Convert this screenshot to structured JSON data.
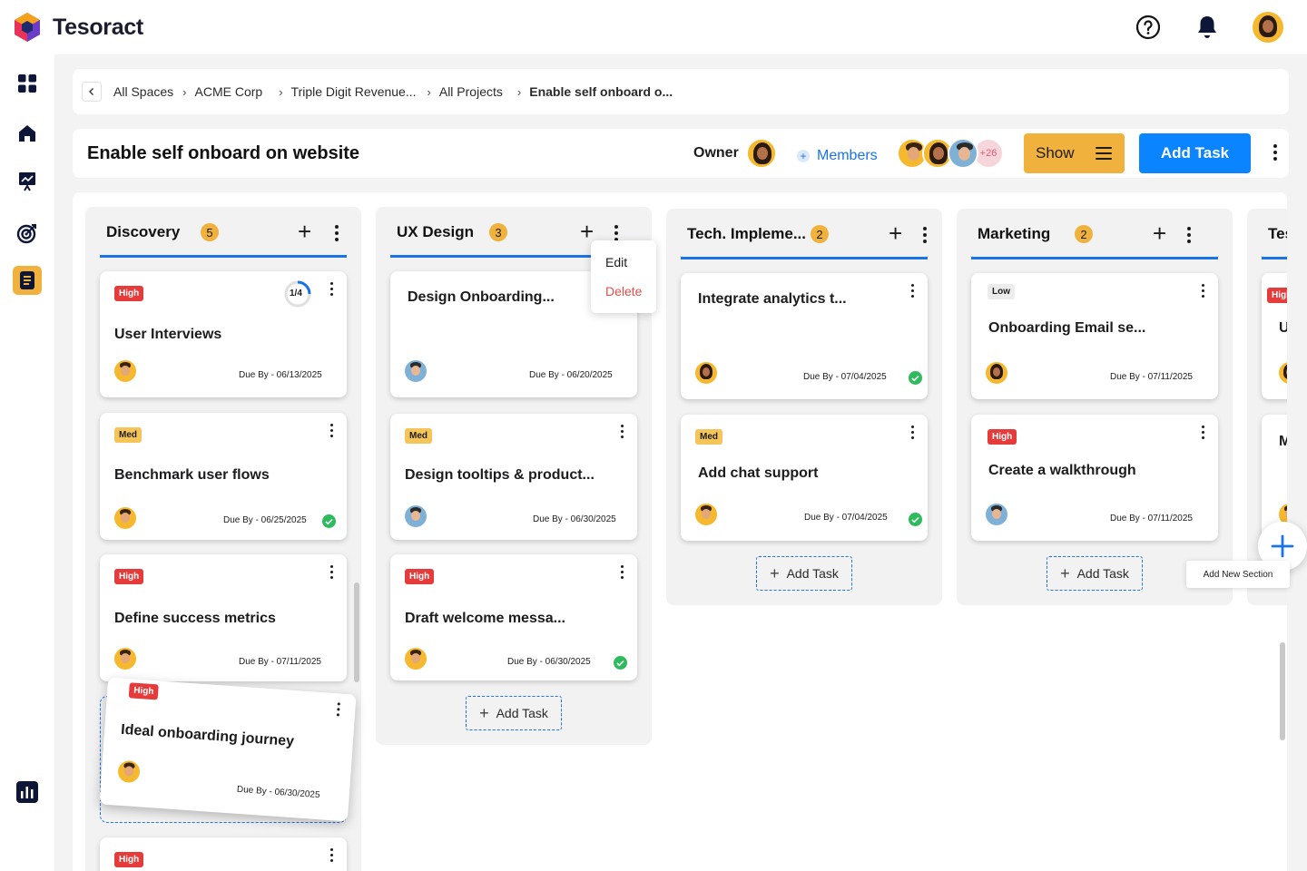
{
  "app": {
    "name": "Tesoract"
  },
  "colors": {
    "accent": "#1a73e8",
    "warning": "#f1b13d",
    "danger": "#e53b3b",
    "success": "#2dbb5d"
  },
  "topbar": {
    "icons": [
      "help-icon",
      "bell-icon",
      "user-avatar"
    ]
  },
  "sidebar": {
    "items": [
      "dashboard-icon",
      "home-icon",
      "presentation-icon",
      "target-icon",
      "document-icon",
      "analytics-icon"
    ],
    "active": "document-icon"
  },
  "breadcrumb": {
    "items": [
      "All Spaces",
      "ACME Corp",
      "Triple Digit Revenue...",
      "All Projects"
    ],
    "current": "Enable self onboard o..."
  },
  "header": {
    "title": "Enable self onboard on website",
    "owner_label": "Owner",
    "members_label": "Members",
    "members_more": "+26",
    "show_label": "Show",
    "add_task_label": "Add Task"
  },
  "columns": [
    {
      "title": "Discovery",
      "count": "5",
      "cards": [
        {
          "tag": "High",
          "title": "User Interviews",
          "due": "Due By - 06/13/2025",
          "progress": "1/4",
          "progress_fraction": 0.25,
          "done": false
        },
        {
          "tag": "Med",
          "title": "Benchmark user flows",
          "due": "Due By - 06/25/2025",
          "done": true
        },
        {
          "tag": "High",
          "title": "Define success metrics",
          "due": "Due By - 07/11/2025",
          "done": false
        },
        {
          "tag": "High",
          "title": "Ideal onboarding journey",
          "due": "Due By - 06/30/2025",
          "done": false,
          "dragging": true
        },
        {
          "tag": "High"
        }
      ]
    },
    {
      "title": "UX Design",
      "count": "3",
      "cards": [
        {
          "title": "Design Onboarding...",
          "due": "Due By - 06/20/2025",
          "done": false
        },
        {
          "tag": "Med",
          "title": "Design tooltips & product...",
          "due": "Due By - 06/30/2025",
          "done": false
        },
        {
          "tag": "High",
          "title": "Draft welcome messa...",
          "due": "Due By - 06/30/2025",
          "done": true
        }
      ],
      "add_task_label": "Add Task"
    },
    {
      "title": "Tech. Impleme...",
      "count": "2",
      "cards": [
        {
          "title": "Integrate analytics t...",
          "due": "Due By - 07/04/2025",
          "done": true
        },
        {
          "tag": "Med",
          "title": "Add chat support",
          "due": "Due By - 07/04/2025",
          "done": true
        }
      ],
      "add_task_label": "Add Task"
    },
    {
      "title": "Marketing",
      "count": "2",
      "cards": [
        {
          "tag": "Low",
          "title": "Onboarding Email se...",
          "due": "Due By - 07/11/2025",
          "done": false
        },
        {
          "tag": "High",
          "title": "Create a walkthrough",
          "due": "Due By - 07/11/2025",
          "done": false
        }
      ],
      "add_task_label": "Add Task"
    },
    {
      "title": "Testin",
      "cards": [
        {
          "tag": "High",
          "title": "Usa"
        },
        {
          "title": "Mor"
        }
      ]
    }
  ],
  "context_menu": {
    "edit": "Edit",
    "delete": "Delete"
  },
  "fab": {
    "tooltip": "Add New Section"
  }
}
